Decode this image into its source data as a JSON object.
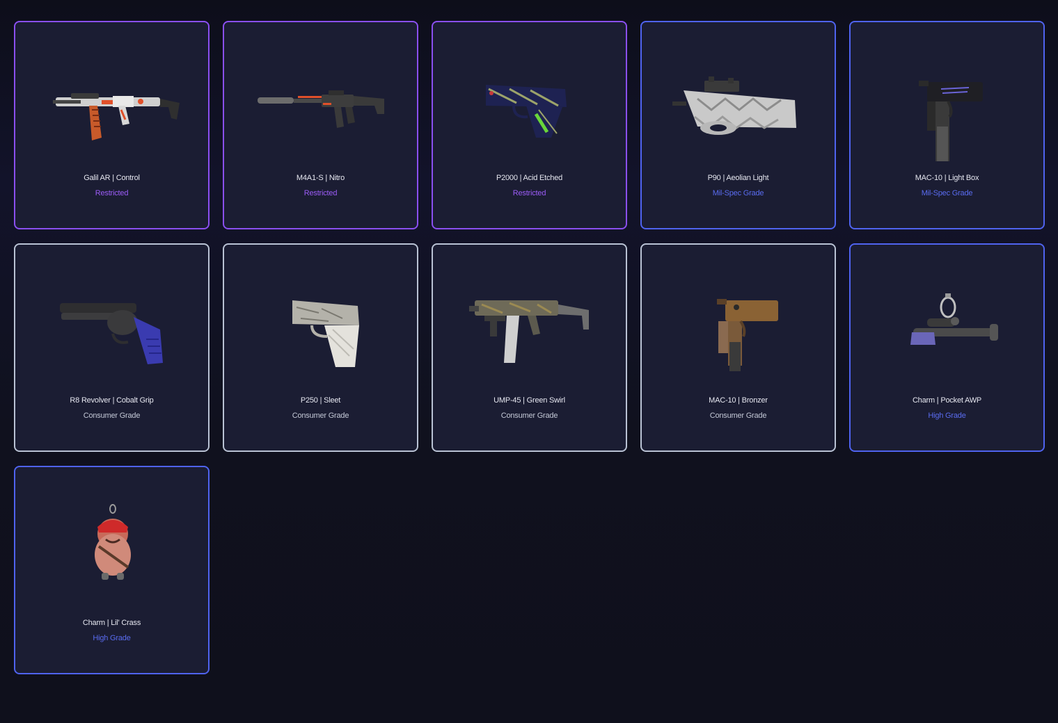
{
  "items": [
    {
      "name": "Galil AR | Control",
      "rarity": "Restricted",
      "icon": "galil-ar-rifle-icon"
    },
    {
      "name": "M4A1-S | Nitro",
      "rarity": "Restricted",
      "icon": "m4a1-s-rifle-icon"
    },
    {
      "name": "P2000 | Acid Etched",
      "rarity": "Restricted",
      "icon": "p2000-pistol-icon"
    },
    {
      "name": "P90 | Aeolian Light",
      "rarity": "Mil-Spec Grade",
      "icon": "p90-smg-icon"
    },
    {
      "name": "MAC-10 | Light Box",
      "rarity": "Mil-Spec Grade",
      "icon": "mac-10-smg-icon"
    },
    {
      "name": "R8 Revolver | Cobalt Grip",
      "rarity": "Consumer Grade",
      "icon": "r8-revolver-icon"
    },
    {
      "name": "P250 | Sleet",
      "rarity": "Consumer Grade",
      "icon": "p250-pistol-icon"
    },
    {
      "name": "UMP-45 | Green Swirl",
      "rarity": "Consumer Grade",
      "icon": "ump-45-smg-icon"
    },
    {
      "name": "MAC-10 | Bronzer",
      "rarity": "Consumer Grade",
      "icon": "mac-10-smg-icon"
    },
    {
      "name": "Charm | Pocket AWP",
      "rarity": "High Grade",
      "icon": "pocket-awp-charm-icon"
    },
    {
      "name": "Charm | Lil' Crass",
      "rarity": "High Grade",
      "icon": "lil-crass-charm-icon"
    }
  ],
  "rarity_colors": {
    "Restricted": "#8a4ff0",
    "Mil-Spec Grade": "#4f63ef",
    "Consumer Grade": "#b9c2d4",
    "High Grade": "#4f63ef"
  },
  "rarity_text_colors": {
    "Restricted": "#9b5cf6",
    "Mil-Spec Grade": "#5a6cf0",
    "Consumer Grade": "#c3c8d6",
    "High Grade": "#5a6cf0"
  }
}
